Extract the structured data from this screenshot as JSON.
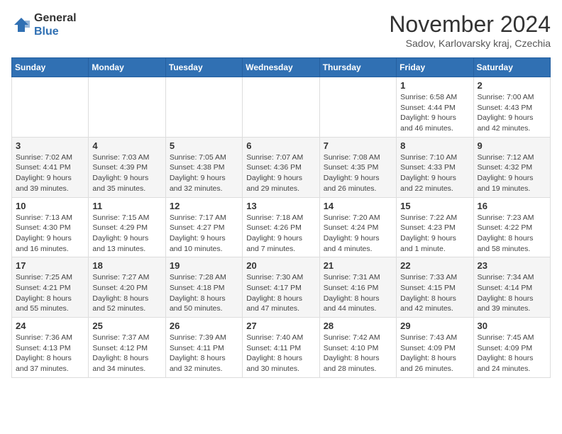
{
  "header": {
    "logo_line1": "General",
    "logo_line2": "Blue",
    "month_title": "November 2024",
    "subtitle": "Sadov, Karlovarsky kraj, Czechia"
  },
  "days_of_week": [
    "Sunday",
    "Monday",
    "Tuesday",
    "Wednesday",
    "Thursday",
    "Friday",
    "Saturday"
  ],
  "weeks": [
    [
      {
        "day": "",
        "info": ""
      },
      {
        "day": "",
        "info": ""
      },
      {
        "day": "",
        "info": ""
      },
      {
        "day": "",
        "info": ""
      },
      {
        "day": "",
        "info": ""
      },
      {
        "day": "1",
        "info": "Sunrise: 6:58 AM\nSunset: 4:44 PM\nDaylight: 9 hours and 46 minutes."
      },
      {
        "day": "2",
        "info": "Sunrise: 7:00 AM\nSunset: 4:43 PM\nDaylight: 9 hours and 42 minutes."
      }
    ],
    [
      {
        "day": "3",
        "info": "Sunrise: 7:02 AM\nSunset: 4:41 PM\nDaylight: 9 hours and 39 minutes."
      },
      {
        "day": "4",
        "info": "Sunrise: 7:03 AM\nSunset: 4:39 PM\nDaylight: 9 hours and 35 minutes."
      },
      {
        "day": "5",
        "info": "Sunrise: 7:05 AM\nSunset: 4:38 PM\nDaylight: 9 hours and 32 minutes."
      },
      {
        "day": "6",
        "info": "Sunrise: 7:07 AM\nSunset: 4:36 PM\nDaylight: 9 hours and 29 minutes."
      },
      {
        "day": "7",
        "info": "Sunrise: 7:08 AM\nSunset: 4:35 PM\nDaylight: 9 hours and 26 minutes."
      },
      {
        "day": "8",
        "info": "Sunrise: 7:10 AM\nSunset: 4:33 PM\nDaylight: 9 hours and 22 minutes."
      },
      {
        "day": "9",
        "info": "Sunrise: 7:12 AM\nSunset: 4:32 PM\nDaylight: 9 hours and 19 minutes."
      }
    ],
    [
      {
        "day": "10",
        "info": "Sunrise: 7:13 AM\nSunset: 4:30 PM\nDaylight: 9 hours and 16 minutes."
      },
      {
        "day": "11",
        "info": "Sunrise: 7:15 AM\nSunset: 4:29 PM\nDaylight: 9 hours and 13 minutes."
      },
      {
        "day": "12",
        "info": "Sunrise: 7:17 AM\nSunset: 4:27 PM\nDaylight: 9 hours and 10 minutes."
      },
      {
        "day": "13",
        "info": "Sunrise: 7:18 AM\nSunset: 4:26 PM\nDaylight: 9 hours and 7 minutes."
      },
      {
        "day": "14",
        "info": "Sunrise: 7:20 AM\nSunset: 4:24 PM\nDaylight: 9 hours and 4 minutes."
      },
      {
        "day": "15",
        "info": "Sunrise: 7:22 AM\nSunset: 4:23 PM\nDaylight: 9 hours and 1 minute."
      },
      {
        "day": "16",
        "info": "Sunrise: 7:23 AM\nSunset: 4:22 PM\nDaylight: 8 hours and 58 minutes."
      }
    ],
    [
      {
        "day": "17",
        "info": "Sunrise: 7:25 AM\nSunset: 4:21 PM\nDaylight: 8 hours and 55 minutes."
      },
      {
        "day": "18",
        "info": "Sunrise: 7:27 AM\nSunset: 4:20 PM\nDaylight: 8 hours and 52 minutes."
      },
      {
        "day": "19",
        "info": "Sunrise: 7:28 AM\nSunset: 4:18 PM\nDaylight: 8 hours and 50 minutes."
      },
      {
        "day": "20",
        "info": "Sunrise: 7:30 AM\nSunset: 4:17 PM\nDaylight: 8 hours and 47 minutes."
      },
      {
        "day": "21",
        "info": "Sunrise: 7:31 AM\nSunset: 4:16 PM\nDaylight: 8 hours and 44 minutes."
      },
      {
        "day": "22",
        "info": "Sunrise: 7:33 AM\nSunset: 4:15 PM\nDaylight: 8 hours and 42 minutes."
      },
      {
        "day": "23",
        "info": "Sunrise: 7:34 AM\nSunset: 4:14 PM\nDaylight: 8 hours and 39 minutes."
      }
    ],
    [
      {
        "day": "24",
        "info": "Sunrise: 7:36 AM\nSunset: 4:13 PM\nDaylight: 8 hours and 37 minutes."
      },
      {
        "day": "25",
        "info": "Sunrise: 7:37 AM\nSunset: 4:12 PM\nDaylight: 8 hours and 34 minutes."
      },
      {
        "day": "26",
        "info": "Sunrise: 7:39 AM\nSunset: 4:11 PM\nDaylight: 8 hours and 32 minutes."
      },
      {
        "day": "27",
        "info": "Sunrise: 7:40 AM\nSunset: 4:11 PM\nDaylight: 8 hours and 30 minutes."
      },
      {
        "day": "28",
        "info": "Sunrise: 7:42 AM\nSunset: 4:10 PM\nDaylight: 8 hours and 28 minutes."
      },
      {
        "day": "29",
        "info": "Sunrise: 7:43 AM\nSunset: 4:09 PM\nDaylight: 8 hours and 26 minutes."
      },
      {
        "day": "30",
        "info": "Sunrise: 7:45 AM\nSunset: 4:09 PM\nDaylight: 8 hours and 24 minutes."
      }
    ]
  ]
}
